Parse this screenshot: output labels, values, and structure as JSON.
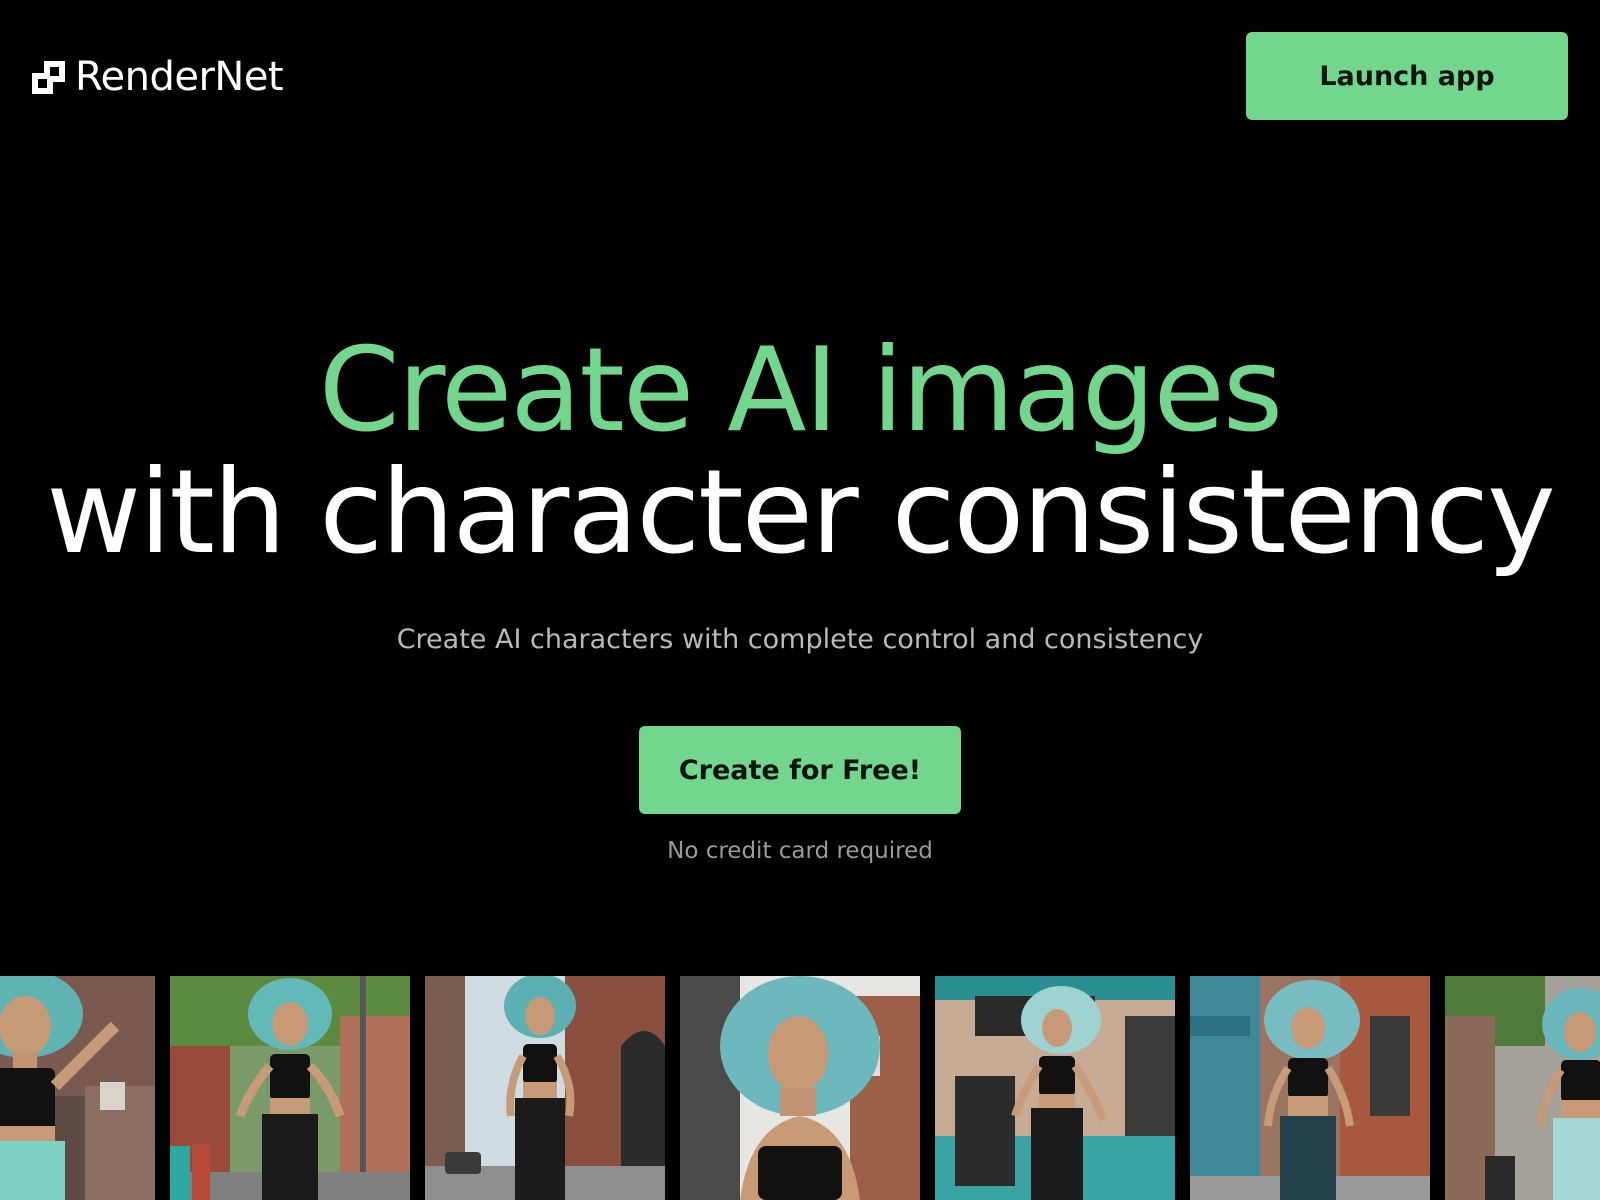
{
  "header": {
    "brand": "RenderNet",
    "launch_label": "Launch app"
  },
  "hero": {
    "headline_line1": "Create AI images",
    "headline_line2": "with character consistency",
    "subtitle": "Create AI characters with complete control and consistency",
    "cta_label": "Create for Free!",
    "cta_note": "No credit card required"
  },
  "gallery": {
    "item_count": 7
  },
  "colors": {
    "background": "#000000",
    "accent": "#72d68c",
    "heading_white": "#ffffff",
    "subtitle_gray": "#b9b9b9",
    "note_gray": "#9a9a9a"
  }
}
